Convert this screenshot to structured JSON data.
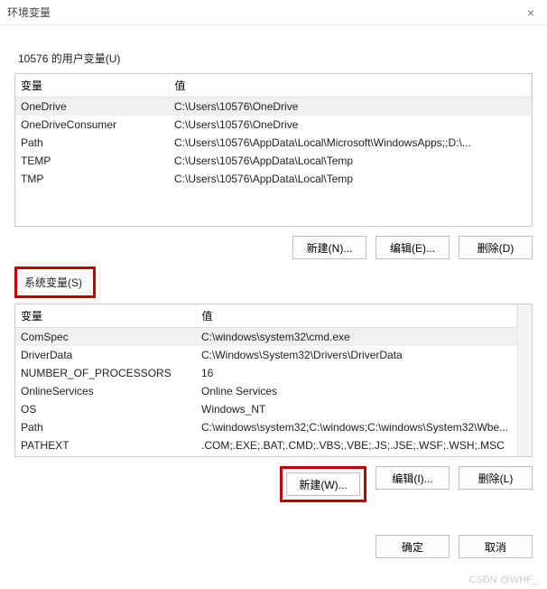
{
  "window": {
    "title": "环境变量",
    "close": "×"
  },
  "user_section": {
    "label": "10576 的用户变量(U)",
    "columns": {
      "var": "变量",
      "val": "值"
    },
    "rows": [
      {
        "var": "OneDrive",
        "val": "C:\\Users\\10576\\OneDrive"
      },
      {
        "var": "OneDriveConsumer",
        "val": "C:\\Users\\10576\\OneDrive"
      },
      {
        "var": "Path",
        "val": "C:\\Users\\10576\\AppData\\Local\\Microsoft\\WindowsApps;;D:\\..."
      },
      {
        "var": "TEMP",
        "val": "C:\\Users\\10576\\AppData\\Local\\Temp"
      },
      {
        "var": "TMP",
        "val": "C:\\Users\\10576\\AppData\\Local\\Temp"
      }
    ],
    "buttons": {
      "new": "新建(N)...",
      "edit": "编辑(E)...",
      "delete": "删除(D)"
    }
  },
  "system_section": {
    "label": "系统变量(S)",
    "columns": {
      "var": "变量",
      "val": "值"
    },
    "rows": [
      {
        "var": "ComSpec",
        "val": "C:\\windows\\system32\\cmd.exe"
      },
      {
        "var": "DriverData",
        "val": "C:\\Windows\\System32\\Drivers\\DriverData"
      },
      {
        "var": "NUMBER_OF_PROCESSORS",
        "val": "16"
      },
      {
        "var": "OnlineServices",
        "val": "Online Services"
      },
      {
        "var": "OS",
        "val": "Windows_NT"
      },
      {
        "var": "Path",
        "val": "C:\\windows\\system32;C:\\windows;C:\\windows\\System32\\Wbe..."
      },
      {
        "var": "PATHEXT",
        "val": ".COM;.EXE;.BAT;.CMD;.VBS;.VBE;.JS;.JSE;.WSF;.WSH;.MSC"
      }
    ],
    "buttons": {
      "new": "新建(W)...",
      "edit": "编辑(I)...",
      "delete": "删除(L)"
    }
  },
  "dialog_buttons": {
    "ok": "确定",
    "cancel": "取消"
  },
  "watermark": "CSDN @WHF_"
}
